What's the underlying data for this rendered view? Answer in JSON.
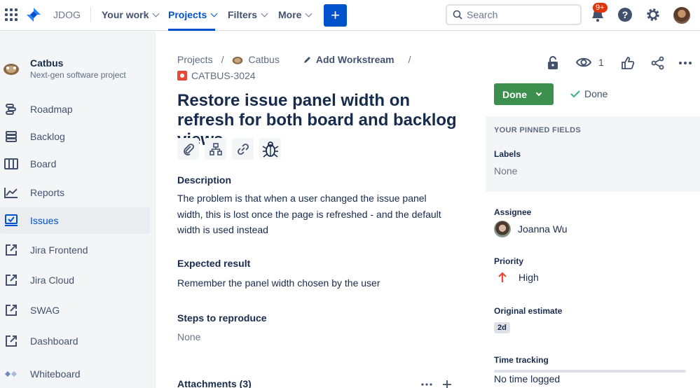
{
  "topnav": {
    "site": "JDOG",
    "items": [
      "Your work",
      "Projects",
      "Filters",
      "More"
    ],
    "create_label": "+",
    "search_placeholder": "Search",
    "notification_count": "9+"
  },
  "sidebar": {
    "project_name": "Catbus",
    "project_type": "Next-gen software project",
    "items": [
      {
        "label": "Roadmap",
        "icon": "roadmap-icon"
      },
      {
        "label": "Backlog",
        "icon": "backlog-icon"
      },
      {
        "label": "Board",
        "icon": "board-icon"
      },
      {
        "label": "Reports",
        "icon": "reports-icon"
      },
      {
        "label": "Issues",
        "icon": "issues-icon"
      },
      {
        "label": "Jira Frontend",
        "icon": "external-link-icon"
      },
      {
        "label": "Jira Cloud",
        "icon": "external-link-icon"
      },
      {
        "label": "SWAG",
        "icon": "external-link-icon"
      },
      {
        "label": "Dashboard",
        "icon": "external-link-icon"
      },
      {
        "label": "Whiteboard",
        "icon": "whiteboard-icon"
      }
    ]
  },
  "breadcrumb": {
    "projects": "Projects",
    "project": "Catbus",
    "add_workstream": "Add Workstream",
    "sep": "/"
  },
  "issue": {
    "key": "CATBUS-3024",
    "title": "Restore issue panel width on refresh for both board and backlog views",
    "description_head": "Description",
    "description": "The problem is that when a user changed the issue panel width, this is lost once the page is refreshed - and the default width is used instead",
    "expected_head": "Expected result",
    "expected": "Remember the panel width chosen by the user",
    "steps_head": "Steps to reproduce",
    "steps": "None",
    "attachments_head": "Attachments (3)"
  },
  "actions": {
    "watch_count": "1",
    "status_button": "Done",
    "resolution": "Done"
  },
  "fields": {
    "pinned_title": "YOUR PINNED FIELDS",
    "labels_label": "Labels",
    "labels_value": "None",
    "assignee_label": "Assignee",
    "assignee_value": "Joanna Wu",
    "priority_label": "Priority",
    "priority_value": "High",
    "estimate_label": "Original estimate",
    "estimate_value": "2d",
    "time_label": "Time tracking",
    "time_value": "No time logged"
  },
  "colors": {
    "brand": "#0052cc",
    "status_done": "#3d8f4e",
    "priority_high": "#e5493a"
  }
}
